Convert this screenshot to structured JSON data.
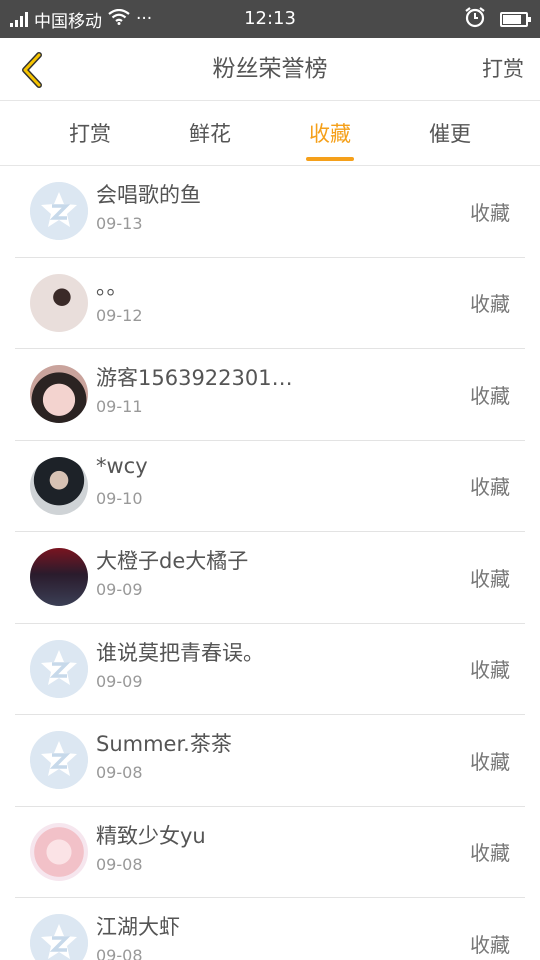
{
  "status": {
    "carrier": "中国移动",
    "more": "···",
    "time": "12:13"
  },
  "header": {
    "title": "粉丝荣誉榜",
    "right_button": "打赏"
  },
  "tabs": [
    {
      "label": "打赏",
      "active": false
    },
    {
      "label": "鲜花",
      "active": false
    },
    {
      "label": "收藏",
      "active": true
    },
    {
      "label": "催更",
      "active": false
    }
  ],
  "accent_color": "#f5a01a",
  "rows": [
    {
      "name": "会唱歌的鱼",
      "date": "09-13",
      "action": "收藏",
      "avatar": "default-avatar-icon"
    },
    {
      "name": "。。",
      "date": "09-12",
      "action": "收藏",
      "avatar": "user-photo"
    },
    {
      "name": "游客1563922301…",
      "date": "09-11",
      "action": "收藏",
      "avatar": "user-photo"
    },
    {
      "name": "*wcy",
      "date": "09-10",
      "action": "收藏",
      "avatar": "user-photo"
    },
    {
      "name": "大橙子de大橘子",
      "date": "09-09",
      "action": "收藏",
      "avatar": "user-photo"
    },
    {
      "name": "谁说莫把青春误。",
      "date": "09-09",
      "action": "收藏",
      "avatar": "default-avatar-icon"
    },
    {
      "name": "Summer.茶茶",
      "date": "09-08",
      "action": "收藏",
      "avatar": "default-avatar-icon"
    },
    {
      "name": "精致少女yu",
      "date": "09-08",
      "action": "收藏",
      "avatar": "user-photo"
    },
    {
      "name": "江湖大虾",
      "date": "09-08",
      "action": "收藏",
      "avatar": "default-avatar-icon"
    }
  ]
}
